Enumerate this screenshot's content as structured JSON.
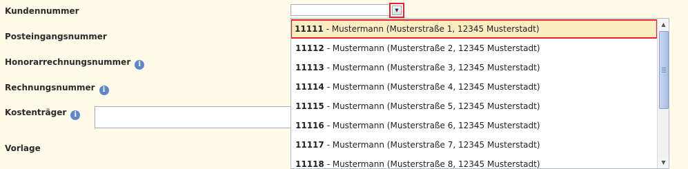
{
  "form": {
    "kundennummer_label": "Kundennummer",
    "posteingang_label": "Posteingangsnummer",
    "honorar_label": "Honorarrechnungsnummer",
    "rechnungsnummer_label": "Rechnungsnummer",
    "kostentraeger_label": "Kostenträger",
    "vorlage_label": "Vorlage",
    "info_glyph": "i"
  },
  "combo": {
    "value": "",
    "arrow_glyph": "▼"
  },
  "dropdown": {
    "items": [
      {
        "number": "11111",
        "text": " - Mustermann (Musterstraße 1, 12345 Musterstadt)"
      },
      {
        "number": "11112",
        "text": " - Mustermann (Musterstraße 2, 12345 Musterstadt)"
      },
      {
        "number": "11113",
        "text": " - Mustermann (Musterstraße 3, 12345 Musterstadt)"
      },
      {
        "number": "11114",
        "text": " - Mustermann (Musterstraße 4, 12345 Musterstadt)"
      },
      {
        "number": "11115",
        "text": " - Mustermann (Musterstraße 5, 12345 Musterstadt)"
      },
      {
        "number": "11116",
        "text": " - Mustermann (Musterstraße 6, 12345 Musterstadt)"
      },
      {
        "number": "11117",
        "text": " - Mustermann (Musterstraße 7, 12345 Musterstadt)"
      },
      {
        "number": "11118",
        "text": " - Mustermann (Musterstraße 8, 12345 Musterstadt)"
      }
    ],
    "scroll_up_glyph": "▲",
    "scroll_down_glyph": "▼"
  }
}
